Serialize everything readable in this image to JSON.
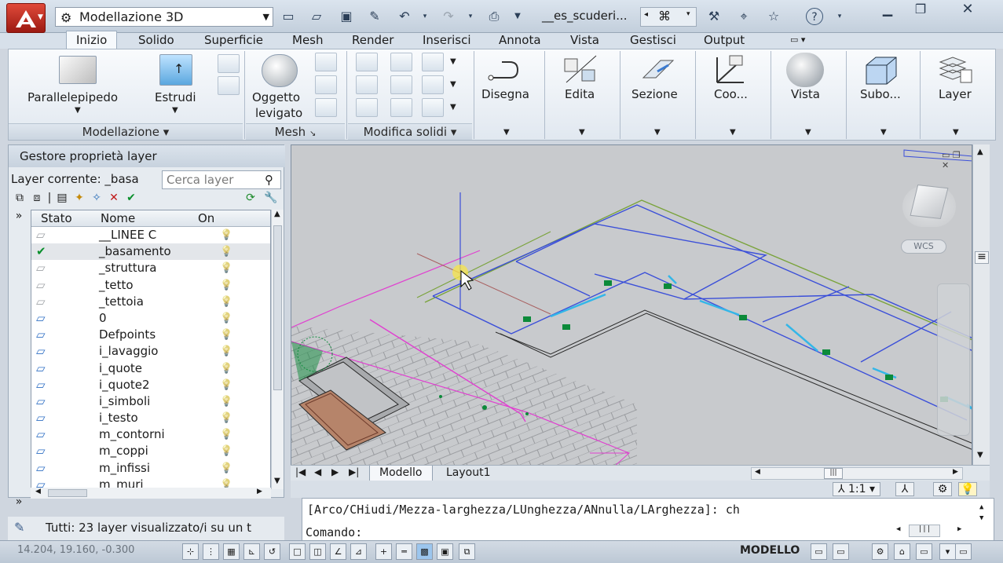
{
  "title_bar": {
    "workspace": "Modellazione 3D",
    "document_title": "__es_scuderi...",
    "icons": [
      "new-icon",
      "open-icon",
      "save-icon",
      "saveas-icon",
      "undo-icon",
      "redo-icon",
      "plot-icon",
      "binoculars-icon",
      "tools-icon",
      "satellite-icon",
      "star-icon",
      "help-icon",
      "minimize-icon",
      "restore-icon",
      "close-icon"
    ]
  },
  "ribbon_tabs": [
    "Inizio",
    "Solido",
    "Superficie",
    "Mesh",
    "Render",
    "Inserisci",
    "Annota",
    "Vista",
    "Gestisci",
    "Output"
  ],
  "ribbon": {
    "modellazione": {
      "title": "Modellazione",
      "parallelepipedo": "Parallelepipedo",
      "estrudi": "Estrudi"
    },
    "mesh": {
      "title": "Mesh",
      "oggetto_line1": "Oggetto",
      "oggetto_line2": "levigato"
    },
    "modifica": {
      "title": "Modifica solidi"
    },
    "disegna": "Disegna",
    "edita": "Edita",
    "sezione": "Sezione",
    "coo": "Coo...",
    "vista": "Vista",
    "subo": "Subo...",
    "layer": "Layer"
  },
  "layer_panel": {
    "title": "Gestore proprietà layer",
    "current_label": "Layer  corrente: _basa",
    "search_placeholder": "Cerca layer",
    "columns": {
      "stato": "Stato",
      "nome": "Nome",
      "on": "On"
    },
    "rows": [
      {
        "name": "__LINEE C",
        "state": "off"
      },
      {
        "name": "_basamento",
        "state": "current"
      },
      {
        "name": "_struttura",
        "state": "off"
      },
      {
        "name": "_tetto",
        "state": "off"
      },
      {
        "name": "_tettoia",
        "state": "off"
      },
      {
        "name": "0",
        "state": "on"
      },
      {
        "name": "Defpoints",
        "state": "on"
      },
      {
        "name": "i_lavaggio",
        "state": "on"
      },
      {
        "name": "i_quote",
        "state": "on"
      },
      {
        "name": "i_quote2",
        "state": "on"
      },
      {
        "name": "i_simboli",
        "state": "on"
      },
      {
        "name": "i_testo",
        "state": "on"
      },
      {
        "name": "m_contorni",
        "state": "on"
      },
      {
        "name": "m_coppi",
        "state": "on"
      },
      {
        "name": "m_infissi",
        "state": "on"
      },
      {
        "name": "m_muri",
        "state": "on"
      }
    ],
    "status": "Tutti: 23 layer visualizzato/i su un t"
  },
  "viewport": {
    "viewcube_label": "WCS",
    "layout_tabs": [
      "Modello",
      "Layout1"
    ]
  },
  "command": {
    "history": "[Arco/CHiudi/Mezza-larghezza/LUnghezza/ANnulla/LArghezza]: ch",
    "prompt": "Comando:"
  },
  "status_bar": {
    "coordinates": "14.204, 19.160, -0.300",
    "model_label": "MODELLO",
    "scale": "1:1"
  },
  "colors": {
    "accent": "#3b4fd9",
    "cyan": "#33b6e8",
    "green": "#0c8a3a",
    "magenta": "#e040d0",
    "olive": "#7aa33b"
  }
}
